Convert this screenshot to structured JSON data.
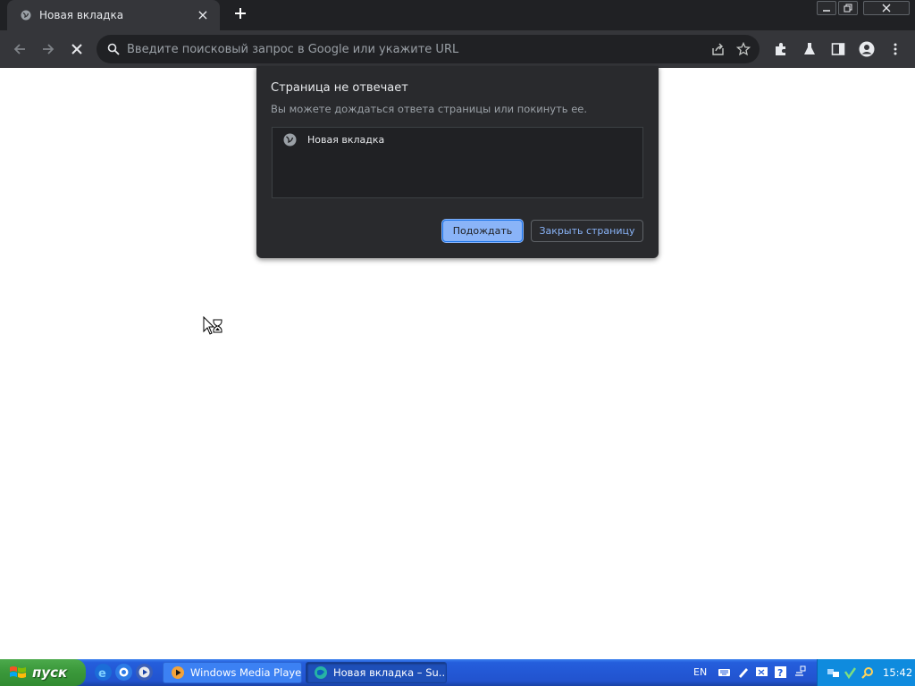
{
  "browser": {
    "tab": {
      "title": "Новая вкладка"
    },
    "new_tab_icon": "plus-icon",
    "window_controls": [
      "minimize-icon",
      "restore-icon",
      "close-icon"
    ],
    "omnibox": {
      "placeholder": "Введите поисковый запрос в Google или укажите URL"
    },
    "toolbar_icons": [
      "back-icon",
      "forward-icon",
      "stop-icon",
      "share-icon",
      "star-icon",
      "extensions-icon",
      "labs-icon",
      "side-panel-icon",
      "profile-icon",
      "menu-icon"
    ]
  },
  "dialog": {
    "title": "Страница не отвечает",
    "subtitle": "Вы можете дождаться ответа страницы или покинуть ее.",
    "items": [
      {
        "label": "Новая вкладка",
        "icon": "globe-icon"
      }
    ],
    "wait_label": "Подождать",
    "close_label": "Закрыть страницу"
  },
  "taskbar": {
    "start_label": "пуск",
    "tasks": [
      {
        "label": "Windows Media Playe...",
        "icon": "media-player-icon"
      },
      {
        "label": "Новая вкладка – Su...",
        "icon": "browser-icon"
      }
    ],
    "language": "EN",
    "clock": "15:42"
  },
  "colors": {
    "dialog_bg": "#292a2d",
    "toolbar_bg": "#35363a",
    "accent": "#8ab4f8",
    "taskbar_blue": "#245edc",
    "start_green": "#3c9a3c"
  }
}
